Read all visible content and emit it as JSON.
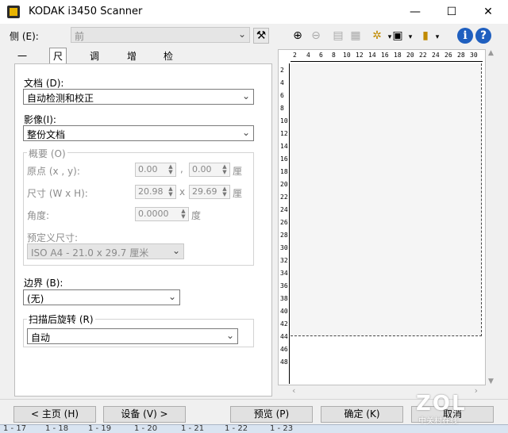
{
  "window": {
    "title": "KODAK i3450 Scanner"
  },
  "titlebar_buttons": {
    "minimize": "—",
    "maximize": "☐",
    "close": "✕"
  },
  "side": {
    "label": "侧 (E):",
    "value": "前"
  },
  "tabs": [
    "一般",
    "尺寸",
    "调整",
    "增强",
    "检测"
  ],
  "active_tab": "尺寸",
  "document": {
    "label": "文档 (D):",
    "value": "自动检测和校正"
  },
  "image": {
    "label": "影像(I):",
    "value": "整份文档"
  },
  "overview": {
    "title": "概要 (O)",
    "origin_label": "原点 (x , y):",
    "origin_x": "0.00",
    "origin_y": "0.00",
    "size_label": "尺寸 (W x H):",
    "width": "20.98",
    "height": "29.69",
    "angle_label": "角度:",
    "angle": "0.0000",
    "angle_unit": "度",
    "unit": "厘",
    "comma": ",",
    "times": "x",
    "predefined_label": "预定义尺寸:",
    "predefined_value": "ISO A4 - 21.0 x 29.7 厘米"
  },
  "border": {
    "label": "边界 (B):",
    "value": "(无)"
  },
  "rotate": {
    "label": "扫描后旋转 (R)",
    "value": "自动"
  },
  "ruler_h": [
    "2",
    "4",
    "6",
    "8",
    "10",
    "12",
    "14",
    "16",
    "18",
    "20",
    "22",
    "24",
    "26",
    "28",
    "30"
  ],
  "ruler_v": [
    "2",
    "4",
    "6",
    "8",
    "10",
    "12",
    "14",
    "16",
    "18",
    "20",
    "22",
    "24",
    "26",
    "28",
    "30",
    "32",
    "34",
    "36",
    "38",
    "40",
    "42",
    "44",
    "46",
    "48"
  ],
  "buttons": {
    "home": "< 主页 (H)",
    "device": "设备 (V) >",
    "preview": "预览 (P)",
    "ok": "确定 (K)",
    "cancel": "取消"
  },
  "bottom_strip": [
    "1 - 17",
    "1 - 18",
    "1 - 19",
    "1 - 20",
    "1 - 21",
    "1 - 22",
    "1 - 23"
  ],
  "watermark": {
    "logo": "ZOL",
    "sub": "中关村在线"
  }
}
